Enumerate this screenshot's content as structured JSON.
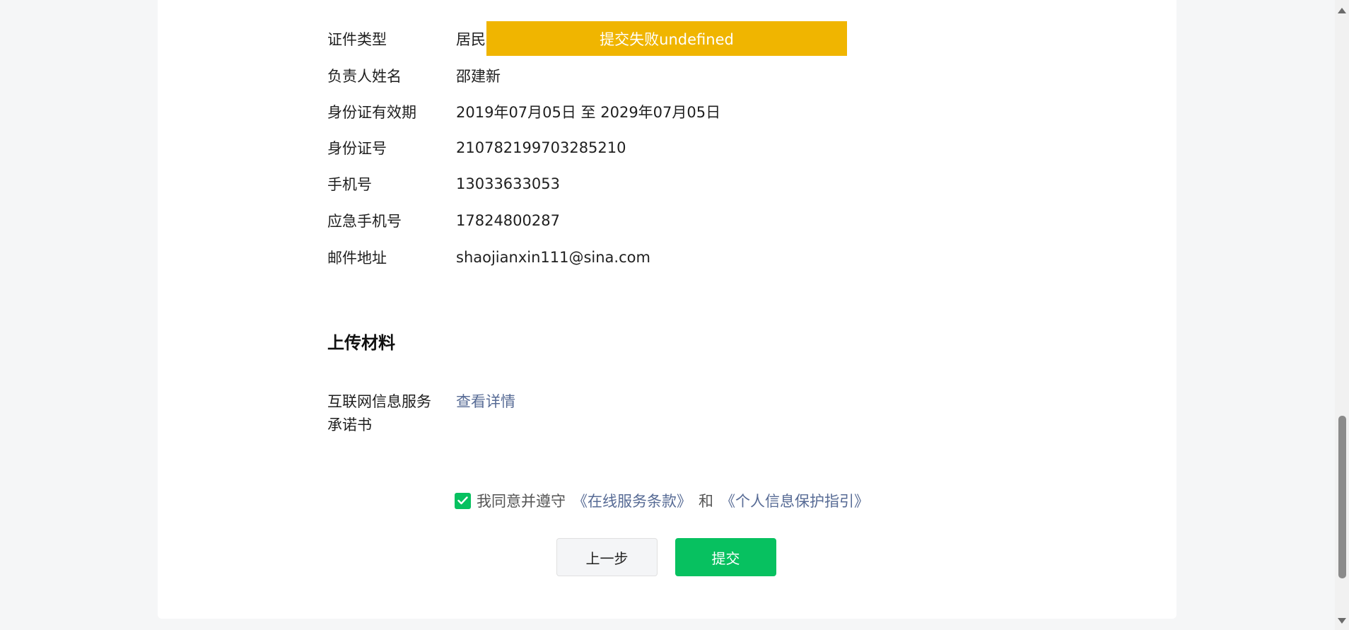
{
  "toast": {
    "message": "提交失败undefined"
  },
  "info_rows": [
    {
      "label": "证件类型",
      "value": "居民"
    },
    {
      "label": "负责人姓名",
      "value": "邵建新"
    },
    {
      "label": "身份证有效期",
      "value": "2019年07月05日 至 2029年07月05日"
    },
    {
      "label": "身份证号",
      "value": "210782199703285210"
    },
    {
      "label": "手机号",
      "value": "13033633053"
    },
    {
      "label": "应急手机号",
      "value": "17824800287"
    },
    {
      "label": "邮件地址",
      "value": "shaojianxin111@sina.com"
    }
  ],
  "upload": {
    "section_title": "上传材料",
    "item_label_line1": "互联网信息服务",
    "item_label_line2": "承诺书",
    "view_link": "查看详情"
  },
  "agreement": {
    "checked": true,
    "prefix": "我同意并遵守",
    "terms_link": "《在线服务条款》",
    "and": "和",
    "privacy_link": "《个人信息保护指引》"
  },
  "buttons": {
    "prev_label": "上一步",
    "submit_label": "提交"
  },
  "colors": {
    "accent": "#07c160",
    "link": "#576b95",
    "toast_bg": "#f0b500"
  },
  "icons": {
    "checkbox": "check-icon",
    "scroll_up": "triangle-up-icon",
    "scroll_down": "triangle-down-icon"
  }
}
